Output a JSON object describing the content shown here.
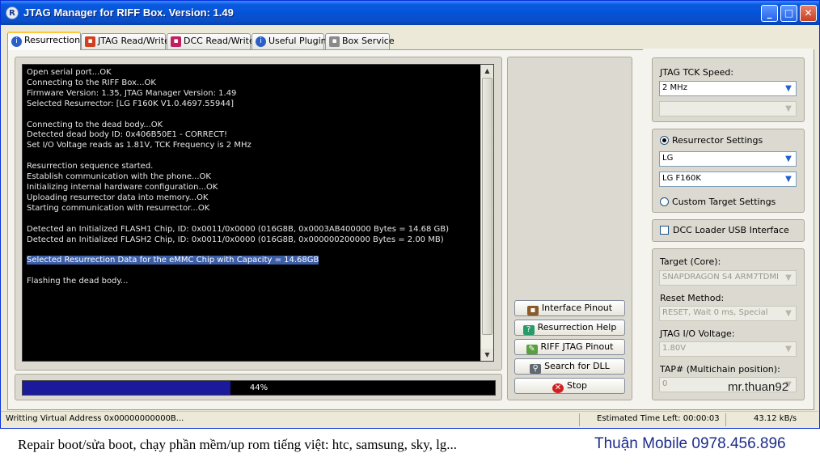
{
  "window": {
    "title": "JTAG Manager for RIFF Box. Version: 1.49",
    "icon": "riff-r-icon"
  },
  "tabs": [
    {
      "label": "Resurrection",
      "icon": "info-icon",
      "active": true
    },
    {
      "label": "JTAG Read/Write",
      "icon": "chip-icon"
    },
    {
      "label": "DCC Read/Write",
      "icon": "dcc-icon"
    },
    {
      "label": "Useful Plugins",
      "icon": "info-icon"
    },
    {
      "label": "Box Service",
      "icon": "box-icon"
    }
  ],
  "log": {
    "lines": [
      "Open serial port...OK",
      "Connecting to the RIFF Box...OK",
      "Firmware Version: 1.35, JTAG Manager Version: 1.49",
      "Selected Resurrector: [LG F160K V1.0.4697.55944]",
      "",
      "Connecting to the dead body...OK",
      "Detected dead body ID: 0x406B50E1 - CORRECT!",
      "Set I/O Voltage reads as 1.81V, TCK Frequency is 2 MHz",
      "",
      "Resurrection sequence started.",
      "Establish communication with the phone...OK",
      "Initializing internal hardware configuration...OK",
      "Uploading resurrector data into memory...OK",
      "Starting communication with resurrector...OK",
      "",
      "Detected an Initialized FLASH1 Chip, ID: 0x0011/0x0000 (016G8B, 0x0003AB400000 Bytes = 14.68 GB)",
      "Detected an Initialized FLASH2 Chip, ID: 0x0011/0x0000 (016G8B, 0x000000200000 Bytes = 2.00 MB)",
      "",
      "Selected Resurrection Data for the eMMC Chip with Capacity = 14.68GB",
      "",
      "Flashing the dead body..."
    ],
    "highlighted_line": "Selected Resurrection Data for the eMMC Chip with Capacity = 14.68GB"
  },
  "progress": {
    "percent": 44,
    "label": "44%",
    "fill_color": "#1a1a9a"
  },
  "buttons": {
    "interface_pinout": "Interface Pinout",
    "resurrection_help": "Resurrection Help",
    "riff_jtag_pinout": "RIFF JTAG Pinout",
    "search_dll": "Search for DLL",
    "stop": "Stop"
  },
  "settings": {
    "tck_speed_label": "JTAG TCK Speed:",
    "tck_speed_value": "2 MHz",
    "resurrector_settings_label": "Resurrector Settings",
    "manufacturer_value": "LG",
    "model_value": "LG F160K",
    "custom_target_label": "Custom Target Settings",
    "dcc_loader_label": "DCC Loader USB Interface",
    "target_core_label": "Target (Core):",
    "target_core_value": "SNAPDRAGON S4 ARM7TDMI",
    "reset_method_label": "Reset Method:",
    "reset_method_value": "RESET, Wait 0 ms, Special",
    "io_voltage_label": "JTAG I/O Voltage:",
    "io_voltage_value": "1.80V",
    "tap_label": "TAP# (Multichain position):",
    "tap_value": "0"
  },
  "watermark": "mr.thuan92",
  "status": {
    "address": "Writting Virtual Address 0x00000000000B...",
    "time_left": "Estimated Time Left: 00:00:03",
    "speed": "43.12 kB/s"
  },
  "footer": {
    "left": "Repair boot/sửa boot, chạy phần mềm/up rom tiếng việt: htc, samsung, sky, lg...",
    "right": "Thuận Mobile 0978.456.896"
  }
}
